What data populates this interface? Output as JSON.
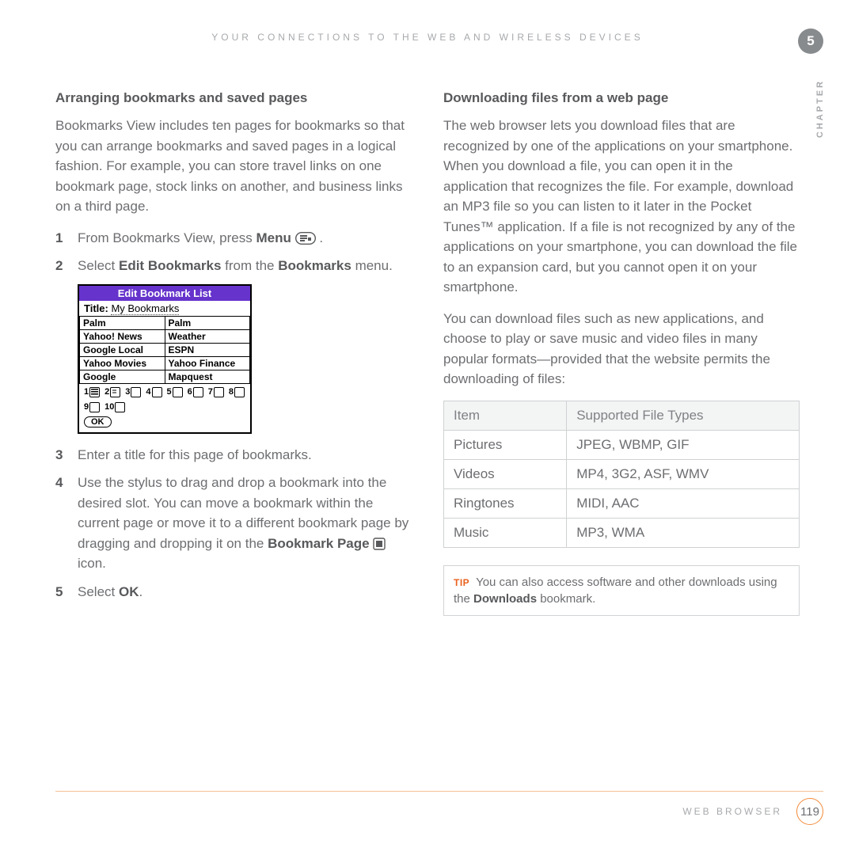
{
  "header": "YOUR CONNECTIONS TO THE WEB AND WIRELESS DEVICES",
  "chapter_number": "5",
  "chapter_side": "CHAPTER",
  "left": {
    "heading": "Arranging bookmarks and saved pages",
    "intro": "Bookmarks View includes ten pages for bookmarks so that you can arrange bookmarks and saved pages in a logical fashion. For example, you can store travel links on one bookmark page, stock links on another, and business links on a third page.",
    "steps": {
      "s1a": "From Bookmarks View, press ",
      "s1b": "Menu",
      "s1c": " .",
      "s2a": "Select ",
      "s2b": "Edit Bookmarks",
      "s2c": " from the ",
      "s2d": "Bookmarks",
      "s2e": " menu.",
      "s3": "Enter a title for this page of bookmarks.",
      "s4a": "Use the stylus to drag and drop a bookmark into the desired slot. You can move a bookmark within the current page or move it to a different bookmark page by dragging and dropping it on the ",
      "s4b": "Bookmark Page",
      "s4c": " icon.",
      "s5a": "Select ",
      "s5b": "OK",
      "s5c": "."
    },
    "widget": {
      "title": "Edit Bookmark List",
      "subtitle_label": "Title:  ",
      "subtitle_value": "My Bookmarks",
      "rows": [
        [
          "Palm",
          "Palm"
        ],
        [
          "Yahoo! News",
          "Weather"
        ],
        [
          "Google Local",
          "ESPN"
        ],
        [
          "Yahoo Movies",
          "Yahoo Finance"
        ],
        [
          "Google",
          "Mapquest"
        ]
      ],
      "pages": [
        "1",
        "2",
        "3",
        "4",
        "5",
        "6",
        "7",
        "8",
        "9",
        "10"
      ],
      "ok": "OK"
    }
  },
  "right": {
    "heading": "Downloading files from a web page",
    "p1": "The web browser lets you download files that are recognized by one of the applications on your smartphone. When you download a file, you can open it in the application that recognizes the file. For example, download an MP3 file so you can listen to it later in the Pocket Tunes™ application. If a file is not recognized by any of the applications on your smartphone, you can download the file to an expansion card, but you cannot open it on your smartphone.",
    "p2": "You can download files such as new applications, and choose to play or save music and video files in many popular formats—provided that the website permits the downloading of files:",
    "table": {
      "headers": [
        "Item",
        "Supported File Types"
      ],
      "rows": [
        [
          "Pictures",
          "JPEG, WBMP, GIF"
        ],
        [
          "Videos",
          "MP4, 3G2, ASF, WMV"
        ],
        [
          "Ringtones",
          "MIDI, AAC"
        ],
        [
          "Music",
          "MP3, WMA"
        ]
      ]
    },
    "tip_label": "TIP",
    "tip_a": " You can also access software and other downloads using the ",
    "tip_b": "Downloads",
    "tip_c": " bookmark."
  },
  "footer": {
    "label": "WEB BROWSER",
    "page": "119"
  }
}
